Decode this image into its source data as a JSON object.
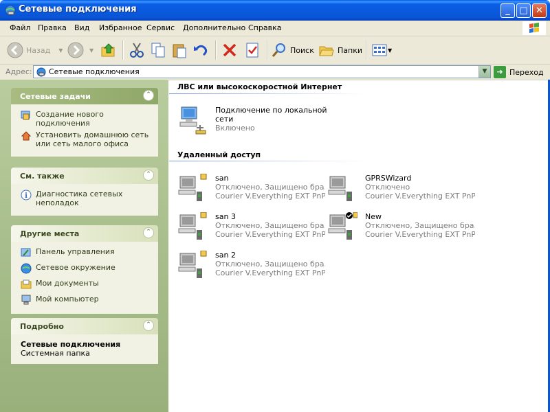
{
  "window": {
    "title": "Сетевые подключения"
  },
  "menu": [
    "Файл",
    "Правка",
    "Вид",
    "Избранное",
    "Сервис",
    "Дополнительно",
    "Справка"
  ],
  "toolbar": {
    "back": "Назад",
    "search": "Поиск",
    "folders": "Папки"
  },
  "address": {
    "label": "Адрес:",
    "value": "Сетевые подключения",
    "go": "Переход"
  },
  "sidebar": {
    "tasks": {
      "title": "Сетевые задачи",
      "items": [
        "Создание нового подключения",
        "Установить домашнюю сеть или сеть малого офиса"
      ]
    },
    "see_also": {
      "title": "См. также",
      "items": [
        "Диагностика сетевых неполадок"
      ]
    },
    "places": {
      "title": "Другие места",
      "items": [
        "Панель управления",
        "Сетевое окружение",
        "Мои документы",
        "Мой компьютер"
      ]
    },
    "details": {
      "title": "Подробно",
      "name": "Сетевые подключения",
      "type": "Системная папка"
    }
  },
  "sections": {
    "lan_title": "ЛВС или высокоскоростной Интернет",
    "remote_title": "Удаленный доступ"
  },
  "lan": [
    {
      "name": "Подключение по локальной сети",
      "status": "Включено"
    }
  ],
  "remote": [
    {
      "name": "san",
      "status": "Отключено, Защищено бра...",
      "device": "Courier V.Everything EXT PnP ..."
    },
    {
      "name": "GPRSWizard",
      "status": "Отключено",
      "device": "Courier V.Everything EXT PnP ..."
    },
    {
      "name": "san 3",
      "status": "Отключено, Защищено бра...",
      "device": "Courier V.Everything EXT PnP ..."
    },
    {
      "name": "New",
      "status": "Отключено, Защищено бра...",
      "device": "Courier V.Everything EXT PnP ..."
    },
    {
      "name": "san 2",
      "status": "Отключено, Защищено бра...",
      "device": "Courier V.Everything EXT PnP ..."
    }
  ]
}
